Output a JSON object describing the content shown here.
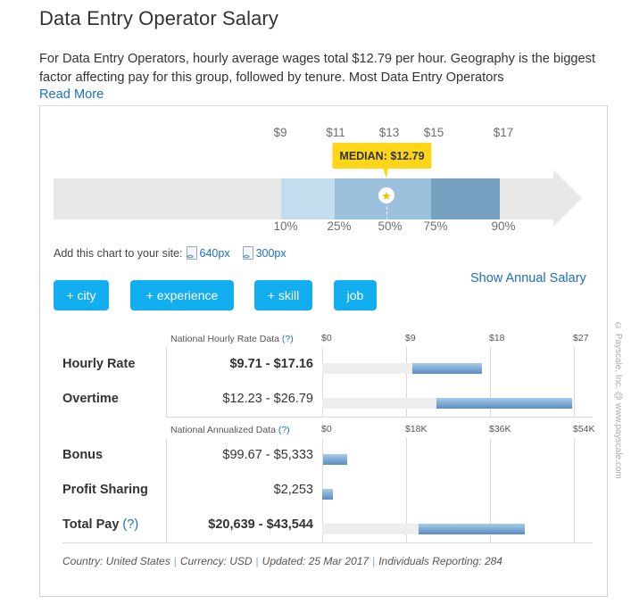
{
  "header": {
    "title": "Data Entry Operator Salary",
    "intro": "For Data Entry Operators, hourly average wages total $12.79 per hour. Geography is the biggest factor affecting pay for this group, followed by tenure. Most Data Entry Operators",
    "read_more": "Read More"
  },
  "range_chart": {
    "dollar_ticks": [
      "$9",
      "$11",
      "$13",
      "$15",
      "$17"
    ],
    "percentile_ticks": [
      "10%",
      "25%",
      "50%",
      "75%",
      "90%"
    ],
    "percentile_values": {
      "p10": 9.71,
      "p25": 11.0,
      "p50": 12.79,
      "p75": 14.8,
      "p90": 17.16
    },
    "median_label": "MEDIAN: $12.79",
    "colors": {
      "track": "#e8e8e8",
      "p10_p25": "#c3ddef",
      "p25_p75": "#9cc1dc",
      "p75_p90": "#779fc0",
      "tooltip": "#ffd617",
      "star": "#f3c200"
    }
  },
  "embed": {
    "label": "Add this chart to your site:",
    "links": [
      "640px",
      "300px"
    ]
  },
  "filters": {
    "buttons": [
      "+ city",
      "+ experience",
      "+ skill",
      "job"
    ],
    "annual_toggle": "Show Annual Salary"
  },
  "hourly_section": {
    "heading": "National Hourly Rate Data",
    "help": "(?)",
    "axis": [
      "$0",
      "$9",
      "$18",
      "$27"
    ],
    "axis_max": 27,
    "rows": [
      {
        "label": "Hourly Rate",
        "value": "$9.71 - $17.16",
        "bold": true,
        "low": 9.71,
        "high": 17.16
      },
      {
        "label": "Overtime",
        "value": "$12.23 - $26.79",
        "bold": false,
        "low": 12.23,
        "high": 26.79
      }
    ]
  },
  "annual_section": {
    "heading": "National Annualized Data",
    "help": "(?)",
    "axis": [
      "$0",
      "$18K",
      "$36K",
      "$54K"
    ],
    "axis_max": 54000,
    "rows": [
      {
        "label": "Bonus",
        "value": "$99.67 - $5,333",
        "bold": false,
        "low": 99.67,
        "high": 5333,
        "track": false
      },
      {
        "label": "Profit Sharing",
        "value": "$2,253",
        "bold": false,
        "low": 0,
        "high": 2253,
        "track": false
      },
      {
        "label": "Total Pay",
        "help": "(?)",
        "value": "$20,639 - $43,544",
        "bold": true,
        "low": 20639,
        "high": 43544,
        "track": true
      }
    ]
  },
  "footnote": {
    "country": "Country: United States",
    "currency": "Currency: USD",
    "updated": "Updated: 25 Mar 2017",
    "reporting": "Individuals Reporting: 284",
    "separator": "|"
  },
  "copyright": "© Payscale, Inc. @ www.payscale.com"
}
